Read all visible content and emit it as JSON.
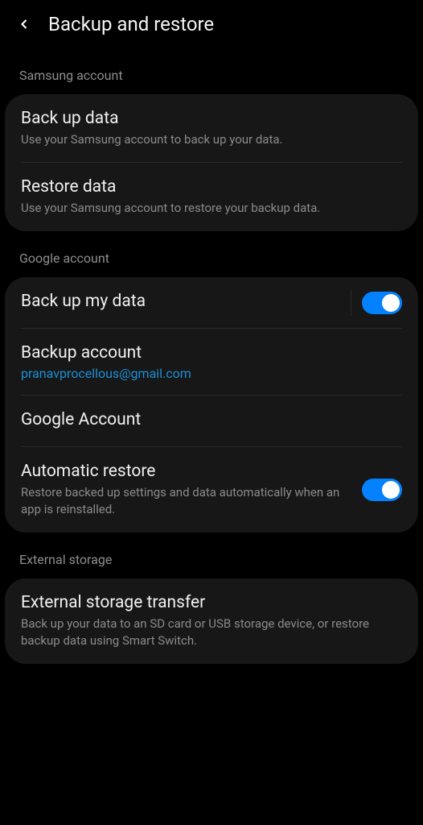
{
  "header": {
    "title": "Backup and restore"
  },
  "sections": {
    "samsung": {
      "label": "Samsung account",
      "items": [
        {
          "title": "Back up data",
          "subtitle": "Use your Samsung account to back up your data."
        },
        {
          "title": "Restore data",
          "subtitle": "Use your Samsung account to restore your backup data."
        }
      ]
    },
    "google": {
      "label": "Google account",
      "items": [
        {
          "title": "Back up my data",
          "toggle": true
        },
        {
          "title": "Backup account",
          "link": "pranavprocellous@gmail.com"
        },
        {
          "title": "Google Account"
        },
        {
          "title": "Automatic restore",
          "subtitle": "Restore backed up settings and data automatically when an app is reinstalled.",
          "toggle": true
        }
      ]
    },
    "external": {
      "label": "External storage",
      "items": [
        {
          "title": "External storage transfer",
          "subtitle": "Back up your data to an SD card or USB storage device, or restore backup data using Smart Switch."
        }
      ]
    }
  }
}
